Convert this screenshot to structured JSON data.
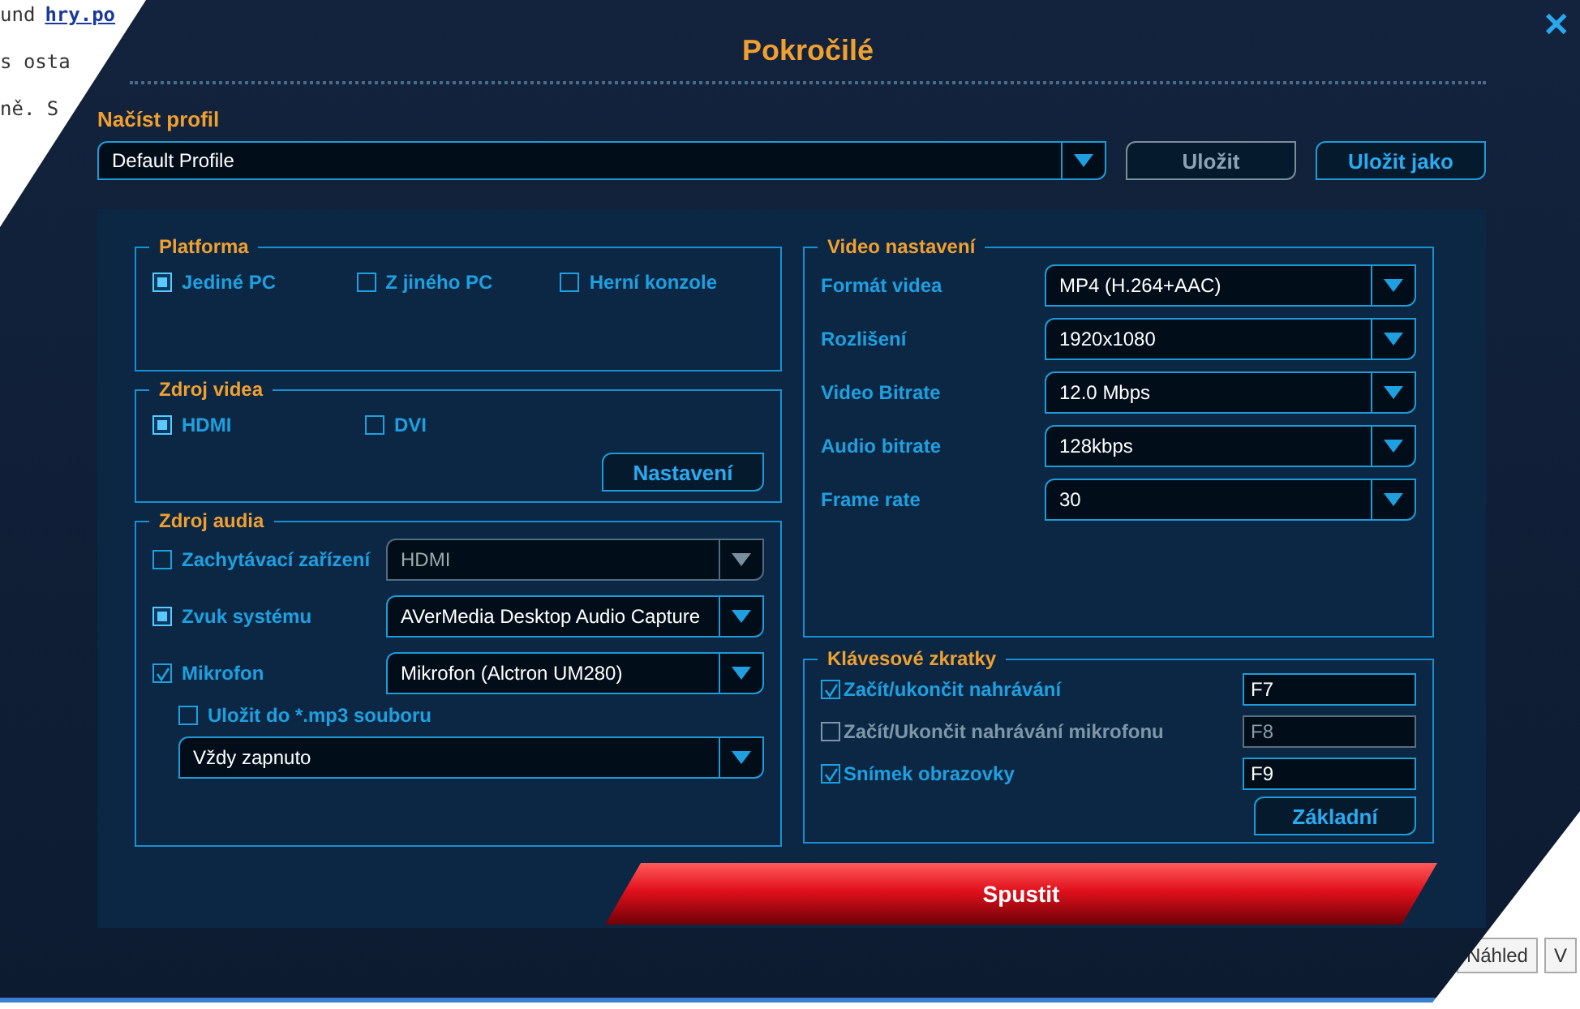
{
  "background_page": {
    "lines": [
      {
        "parts": [
          {
            "kind": "text",
            "text": "und"
          },
          {
            "kind": "link",
            "text": "hry.po"
          }
        ]
      },
      {
        "parts": [
          {
            "kind": "text",
            "text": "s osta"
          }
        ]
      },
      {
        "parts": [
          {
            "kind": "text",
            "text": "ně. S"
          }
        ]
      }
    ],
    "buttons": [
      "Náhled",
      "V"
    ]
  },
  "dialog": {
    "title": "Pokročilé",
    "close_glyph": "✕",
    "profile": {
      "label": "Načíst profil",
      "value": "Default Profile",
      "buttons": [
        {
          "label": "Uložit",
          "disabled": true
        },
        {
          "label": "Uložit jako",
          "disabled": false
        }
      ]
    },
    "platform": {
      "title": "Platforma",
      "options": [
        {
          "label": "Jediné PC",
          "selected": true
        },
        {
          "label": "Z jiného PC",
          "selected": false
        },
        {
          "label": "Herní konzole",
          "selected": false
        }
      ]
    },
    "video_source": {
      "title": "Zdroj videa",
      "options": [
        {
          "label": "HDMI",
          "selected": true
        },
        {
          "label": "DVI",
          "selected": false
        }
      ],
      "button": "Nastavení"
    },
    "audio_source": {
      "title": "Zdroj audia",
      "rows": [
        {
          "kind": "dot",
          "label": "Zachytávací zařízení",
          "checked": false,
          "value": "HDMI",
          "disabled": true
        },
        {
          "kind": "dot",
          "label": "Zvuk systému",
          "checked": true,
          "value": "AVerMedia Desktop Audio Capture",
          "disabled": false
        },
        {
          "kind": "tick",
          "label": "Mikrofon",
          "checked": true,
          "value": "Mikrofon (Alctron UM280)",
          "disabled": false
        }
      ],
      "save_mp3": {
        "label": "Uložit do *.mp3 souboru",
        "checked": false
      },
      "mode": "Vždy zapnuto"
    },
    "video_settings": {
      "title": "Video nastavení",
      "rows": [
        {
          "label": "Formát videa",
          "value": "MP4 (H.264+AAC)"
        },
        {
          "label": "Rozlišení",
          "value": "1920x1080"
        },
        {
          "label": "Video Bitrate",
          "value": "12.0 Mbps"
        },
        {
          "label": "Audio bitrate",
          "value": "128kbps"
        },
        {
          "label": "Frame rate",
          "value": "30"
        }
      ]
    },
    "shortcuts": {
      "title": "Klávesové zkratky",
      "rows": [
        {
          "label": "Začít/ukončit nahrávání",
          "checked": true,
          "key": "F7"
        },
        {
          "label": "Začít/Ukončit nahrávání mikrofonu",
          "checked": false,
          "key": "F8"
        },
        {
          "label": "Snímek obrazovky",
          "checked": true,
          "key": "F9"
        }
      ],
      "button": "Základní"
    },
    "start_button": "Spustit"
  }
}
